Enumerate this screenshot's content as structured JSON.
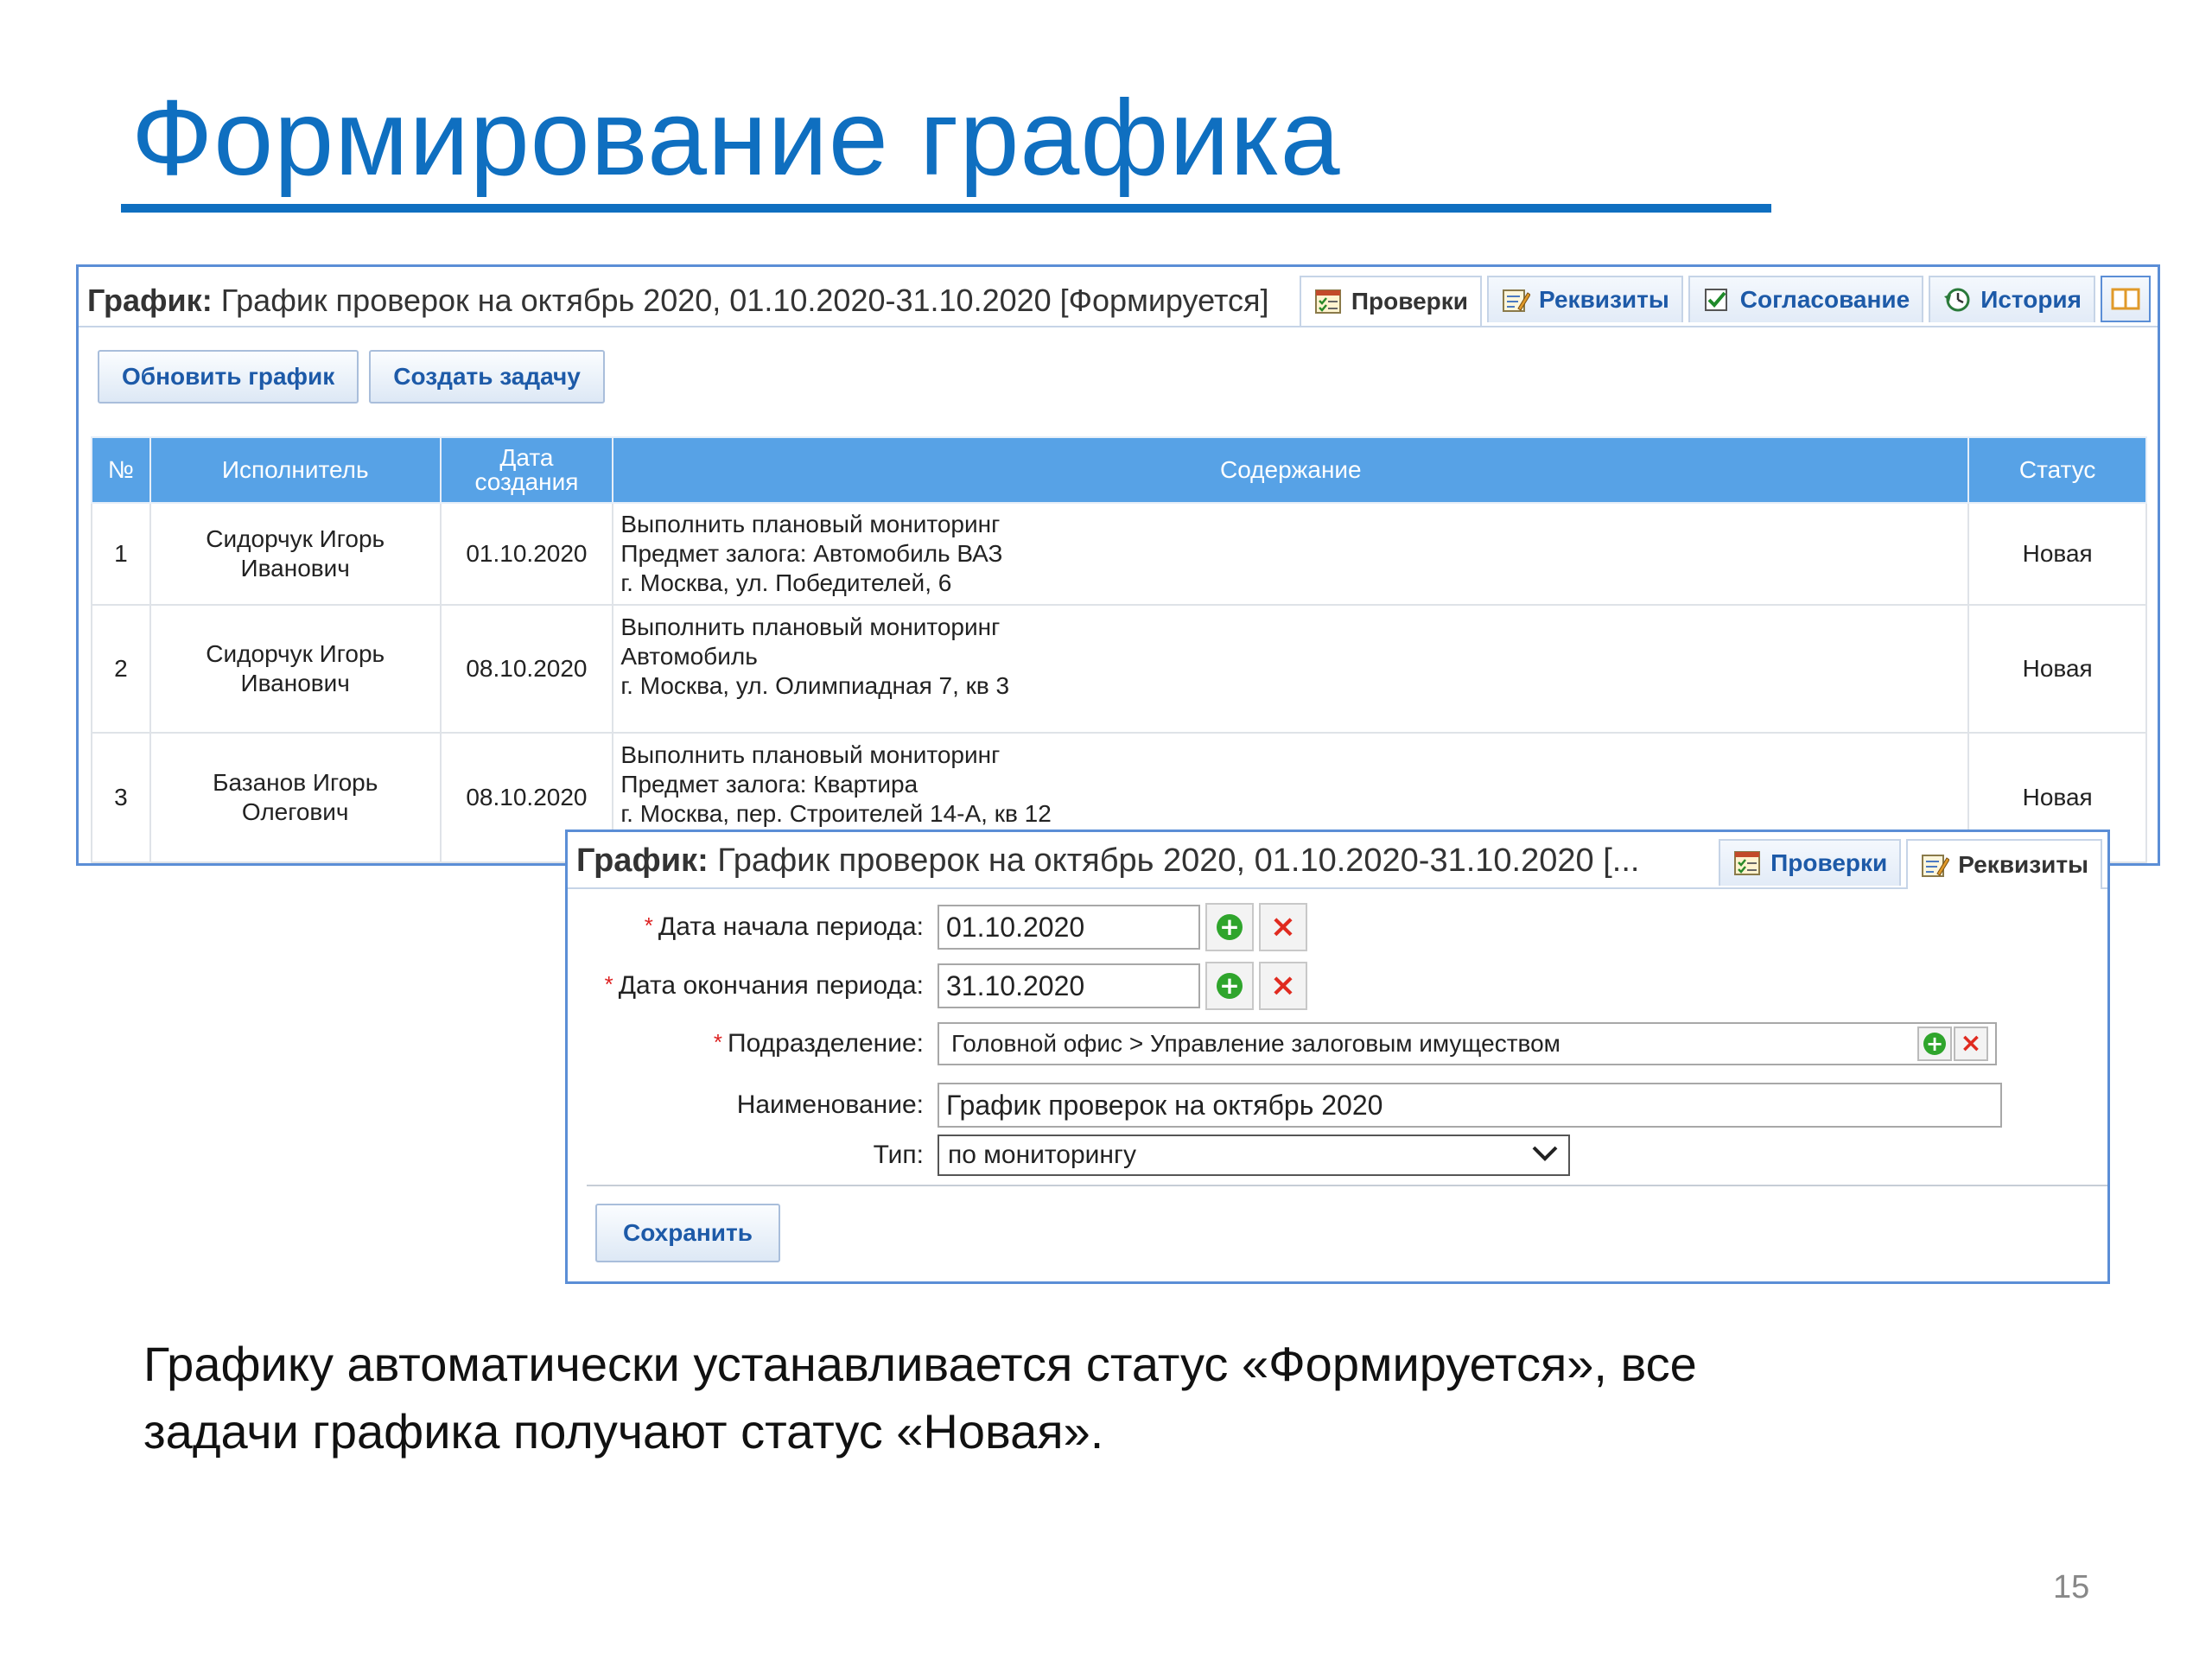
{
  "slide": {
    "title": "Формирование графика",
    "body_line1": "Графику автоматически устанавливается статус «Формируется», все",
    "body_line2": "задачи графика получают статус «Новая».",
    "page_number": "15"
  },
  "window1": {
    "caption_prefix": "График:",
    "caption_text": " График проверок на октябрь 2020, 01.10.2020-31.10.2020 [Формируется]",
    "tabs": [
      {
        "label": "Проверки",
        "icon": "checklist-icon",
        "active": true
      },
      {
        "label": "Реквизиты",
        "icon": "edit-document-icon",
        "active": false
      },
      {
        "label": "Согласование",
        "icon": "checkbox-icon",
        "active": false
      },
      {
        "label": "История",
        "icon": "history-icon",
        "active": false
      }
    ],
    "buttons": {
      "refresh": "Обновить график",
      "create_task": "Создать задачу"
    },
    "table": {
      "headers": {
        "num": "№",
        "executor": "Исполнитель",
        "date_l1": "Дата",
        "date_l2": "создания",
        "content": "Содержание",
        "status": "Статус"
      },
      "rows": [
        {
          "num": "1",
          "exec_l1": "Сидорчук Игорь",
          "exec_l2": "Иванович",
          "date": "01.10.2020",
          "content_l1": "Выполнить плановый мониторинг",
          "content_l2": "Предмет залога: Автомобиль ВАЗ",
          "content_l3": "г. Москва, ул. Победителей, 6",
          "status": "Новая"
        },
        {
          "num": "2",
          "exec_l1": "Сидорчук Игорь",
          "exec_l2": "Иванович",
          "date": "08.10.2020",
          "content_l1": "Выполнить плановый мониторинг",
          "content_l2": "Автомобиль",
          "content_l3": "г. Москва, ул. Олимпиадная 7, кв 3",
          "status": "Новая"
        },
        {
          "num": "3",
          "exec_l1": "Базанов Игорь",
          "exec_l2": "Олегович",
          "date": "08.10.2020",
          "content_l1": "Выполнить плановый мониторинг",
          "content_l2": "Предмет залога: Квартира",
          "content_l3": "г. Москва, пер. Строителей 14-А, кв 12",
          "status": "Новая"
        }
      ]
    }
  },
  "window2": {
    "caption_prefix": "График:",
    "caption_text": " График проверок на октябрь 2020, 01.10.2020-31.10.2020 [...",
    "tabs": [
      {
        "label": "Проверки",
        "icon": "checklist-icon",
        "active": false
      },
      {
        "label": "Реквизиты",
        "icon": "edit-document-icon",
        "active": true
      }
    ],
    "form": {
      "start_label": "Дата начала периода:",
      "start_value": "01.10.2020",
      "end_label": "Дата окончания периода:",
      "end_value": "31.10.2020",
      "division_label": "Подразделение:",
      "division_value": "Головной офис > Управление залоговым имуществом",
      "name_label": "Наименование:",
      "name_value": "График проверок на октябрь 2020",
      "type_label": "Тип:",
      "type_value": "по мониторингу",
      "required_mark": "*",
      "save_label": "Сохранить"
    }
  },
  "colors": {
    "title_blue": "#0f6fc0",
    "header_blue": "#57a2e6",
    "window_border": "#5b8ed6",
    "link_blue": "#1d5aa8",
    "required_red": "#d22222",
    "add_green": "#2fa52c",
    "remove_red": "#e02b20"
  }
}
